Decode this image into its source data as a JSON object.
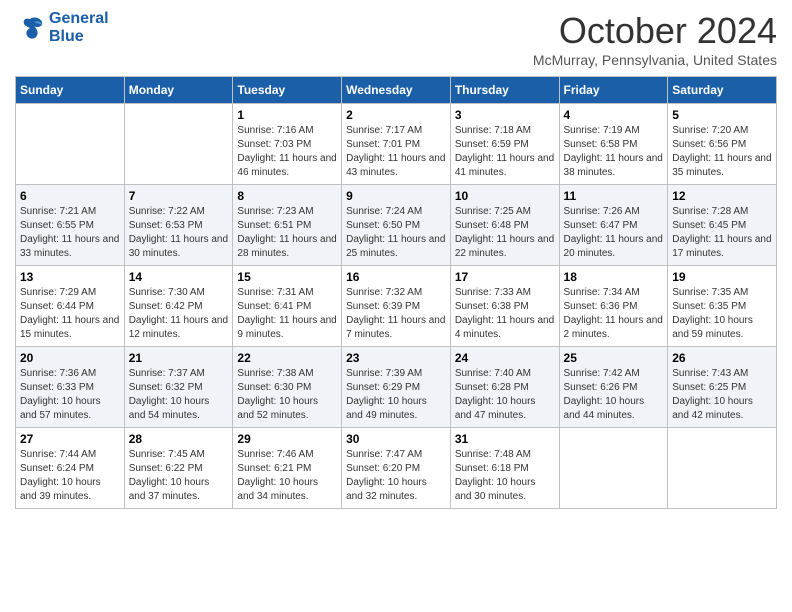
{
  "header": {
    "logo_line1": "General",
    "logo_line2": "Blue",
    "month_title": "October 2024",
    "location": "McMurray, Pennsylvania, United States"
  },
  "weekdays": [
    "Sunday",
    "Monday",
    "Tuesday",
    "Wednesday",
    "Thursday",
    "Friday",
    "Saturday"
  ],
  "weeks": [
    [
      {
        "day": "",
        "info": ""
      },
      {
        "day": "",
        "info": ""
      },
      {
        "day": "1",
        "info": "Sunrise: 7:16 AM\nSunset: 7:03 PM\nDaylight: 11 hours and 46 minutes."
      },
      {
        "day": "2",
        "info": "Sunrise: 7:17 AM\nSunset: 7:01 PM\nDaylight: 11 hours and 43 minutes."
      },
      {
        "day": "3",
        "info": "Sunrise: 7:18 AM\nSunset: 6:59 PM\nDaylight: 11 hours and 41 minutes."
      },
      {
        "day": "4",
        "info": "Sunrise: 7:19 AM\nSunset: 6:58 PM\nDaylight: 11 hours and 38 minutes."
      },
      {
        "day": "5",
        "info": "Sunrise: 7:20 AM\nSunset: 6:56 PM\nDaylight: 11 hours and 35 minutes."
      }
    ],
    [
      {
        "day": "6",
        "info": "Sunrise: 7:21 AM\nSunset: 6:55 PM\nDaylight: 11 hours and 33 minutes."
      },
      {
        "day": "7",
        "info": "Sunrise: 7:22 AM\nSunset: 6:53 PM\nDaylight: 11 hours and 30 minutes."
      },
      {
        "day": "8",
        "info": "Sunrise: 7:23 AM\nSunset: 6:51 PM\nDaylight: 11 hours and 28 minutes."
      },
      {
        "day": "9",
        "info": "Sunrise: 7:24 AM\nSunset: 6:50 PM\nDaylight: 11 hours and 25 minutes."
      },
      {
        "day": "10",
        "info": "Sunrise: 7:25 AM\nSunset: 6:48 PM\nDaylight: 11 hours and 22 minutes."
      },
      {
        "day": "11",
        "info": "Sunrise: 7:26 AM\nSunset: 6:47 PM\nDaylight: 11 hours and 20 minutes."
      },
      {
        "day": "12",
        "info": "Sunrise: 7:28 AM\nSunset: 6:45 PM\nDaylight: 11 hours and 17 minutes."
      }
    ],
    [
      {
        "day": "13",
        "info": "Sunrise: 7:29 AM\nSunset: 6:44 PM\nDaylight: 11 hours and 15 minutes."
      },
      {
        "day": "14",
        "info": "Sunrise: 7:30 AM\nSunset: 6:42 PM\nDaylight: 11 hours and 12 minutes."
      },
      {
        "day": "15",
        "info": "Sunrise: 7:31 AM\nSunset: 6:41 PM\nDaylight: 11 hours and 9 minutes."
      },
      {
        "day": "16",
        "info": "Sunrise: 7:32 AM\nSunset: 6:39 PM\nDaylight: 11 hours and 7 minutes."
      },
      {
        "day": "17",
        "info": "Sunrise: 7:33 AM\nSunset: 6:38 PM\nDaylight: 11 hours and 4 minutes."
      },
      {
        "day": "18",
        "info": "Sunrise: 7:34 AM\nSunset: 6:36 PM\nDaylight: 11 hours and 2 minutes."
      },
      {
        "day": "19",
        "info": "Sunrise: 7:35 AM\nSunset: 6:35 PM\nDaylight: 10 hours and 59 minutes."
      }
    ],
    [
      {
        "day": "20",
        "info": "Sunrise: 7:36 AM\nSunset: 6:33 PM\nDaylight: 10 hours and 57 minutes."
      },
      {
        "day": "21",
        "info": "Sunrise: 7:37 AM\nSunset: 6:32 PM\nDaylight: 10 hours and 54 minutes."
      },
      {
        "day": "22",
        "info": "Sunrise: 7:38 AM\nSunset: 6:30 PM\nDaylight: 10 hours and 52 minutes."
      },
      {
        "day": "23",
        "info": "Sunrise: 7:39 AM\nSunset: 6:29 PM\nDaylight: 10 hours and 49 minutes."
      },
      {
        "day": "24",
        "info": "Sunrise: 7:40 AM\nSunset: 6:28 PM\nDaylight: 10 hours and 47 minutes."
      },
      {
        "day": "25",
        "info": "Sunrise: 7:42 AM\nSunset: 6:26 PM\nDaylight: 10 hours and 44 minutes."
      },
      {
        "day": "26",
        "info": "Sunrise: 7:43 AM\nSunset: 6:25 PM\nDaylight: 10 hours and 42 minutes."
      }
    ],
    [
      {
        "day": "27",
        "info": "Sunrise: 7:44 AM\nSunset: 6:24 PM\nDaylight: 10 hours and 39 minutes."
      },
      {
        "day": "28",
        "info": "Sunrise: 7:45 AM\nSunset: 6:22 PM\nDaylight: 10 hours and 37 minutes."
      },
      {
        "day": "29",
        "info": "Sunrise: 7:46 AM\nSunset: 6:21 PM\nDaylight: 10 hours and 34 minutes."
      },
      {
        "day": "30",
        "info": "Sunrise: 7:47 AM\nSunset: 6:20 PM\nDaylight: 10 hours and 32 minutes."
      },
      {
        "day": "31",
        "info": "Sunrise: 7:48 AM\nSunset: 6:18 PM\nDaylight: 10 hours and 30 minutes."
      },
      {
        "day": "",
        "info": ""
      },
      {
        "day": "",
        "info": ""
      }
    ]
  ]
}
